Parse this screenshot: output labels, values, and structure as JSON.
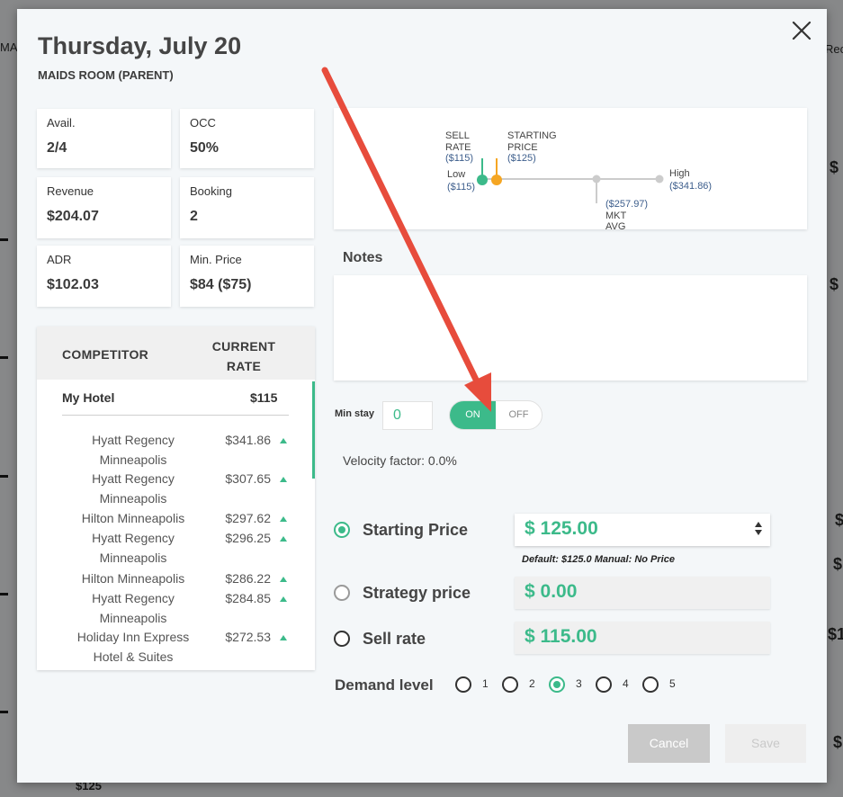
{
  "background": {
    "left_fragment": "MA",
    "right_fragment": "Rec",
    "bottom_fragment": "$125",
    "right_values": [
      "$",
      "$",
      "$",
      "$",
      "$1",
      "$"
    ]
  },
  "modal": {
    "date_title": "Thursday, July 20",
    "room_name": "MAIDS ROOM (PARENT)"
  },
  "kpis": [
    {
      "label": "Avail.",
      "value": "2/4"
    },
    {
      "label": "OCC",
      "value": "50%"
    },
    {
      "label": "Revenue",
      "value": "$204.07"
    },
    {
      "label": "Booking",
      "value": "2"
    },
    {
      "label": "ADR",
      "value": "$102.03"
    },
    {
      "label": "Min. Price",
      "value": "$84 ($75)"
    }
  ],
  "competitors": {
    "header_competitor": "COMPETITOR",
    "header_rate": "CURRENT RATE",
    "my_hotel": {
      "name": "My Hotel",
      "rate": "$115"
    },
    "rows": [
      {
        "name": "Hyatt Regency Minneapolis",
        "rate": "$341.86",
        "trend": "up"
      },
      {
        "name": "Hyatt Regency Minneapolis",
        "rate": "$307.65",
        "trend": "up"
      },
      {
        "name": "Hilton Minneapolis",
        "rate": "$297.62",
        "trend": "up"
      },
      {
        "name": "Hyatt Regency Minneapolis",
        "rate": "$296.25",
        "trend": "up"
      },
      {
        "name": "Hilton Minneapolis",
        "rate": "$286.22",
        "trend": "up"
      },
      {
        "name": "Hyatt Regency Minneapolis",
        "rate": "$284.85",
        "trend": "up"
      },
      {
        "name": "Holiday Inn Express Hotel & Suites",
        "rate": "$272.53",
        "trend": "up"
      }
    ]
  },
  "price_range": {
    "sell_rate_l1": "SELL",
    "sell_rate_l2": "RATE",
    "sell_rate_val": "($115)",
    "starting_l1": "STARTING",
    "starting_l2": "PRICE",
    "starting_val": "($125)",
    "low_label": "Low",
    "low_val": "($115)",
    "high_label": "High",
    "high_val": "($341.86)",
    "mkt_val": "($257.97)",
    "mkt_l1": "MKT",
    "mkt_l2": "AVG",
    "colors": {
      "sell": "#3cba8a",
      "starting": "#f5a623",
      "track": "#cccccc"
    }
  },
  "notes": {
    "label": "Notes",
    "value": ""
  },
  "min_stay": {
    "label": "Min stay",
    "value": "0",
    "on_label": "ON",
    "off_label": "OFF",
    "state": "on"
  },
  "velocity": "Velocity factor: 0.0%",
  "pricing": {
    "starting": {
      "label": "Starting Price",
      "value": "$ 125.00",
      "selected": true
    },
    "defaults": "Default: $125.0   Manual: No Price",
    "strategy": {
      "label": "Strategy price",
      "value": "$ 0.00",
      "selected": false
    },
    "sell": {
      "label": "Sell rate",
      "value": "$ 115.00",
      "selected": false
    }
  },
  "demand": {
    "label": "Demand level",
    "levels": [
      "1",
      "2",
      "3",
      "4",
      "5"
    ],
    "selected": "3"
  },
  "buttons": {
    "cancel": "Cancel",
    "save": "Save"
  },
  "accent_color": "#3cba8a",
  "annotation_arrow_color": "#e74c3c"
}
